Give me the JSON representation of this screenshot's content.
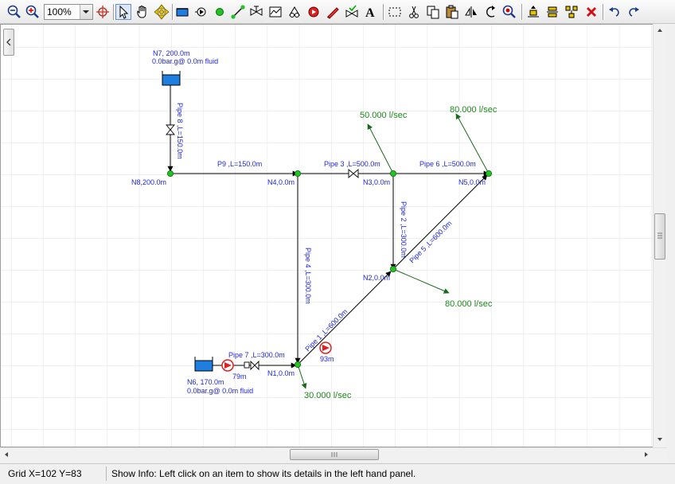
{
  "toolbar": {
    "zoom_value": "100%",
    "tools": [
      {
        "name": "zoom-out-icon"
      },
      {
        "name": "zoom-in-icon"
      },
      {
        "name": "zoom-target-icon"
      },
      {
        "name": "select-pointer-icon"
      },
      {
        "name": "pan-hand-icon"
      },
      {
        "name": "move-arrows-icon"
      },
      {
        "name": "tank-icon"
      },
      {
        "name": "pump-icon"
      },
      {
        "name": "node-icon"
      },
      {
        "name": "pipe-icon"
      },
      {
        "name": "valve-icon"
      },
      {
        "name": "chart-icon"
      },
      {
        "name": "component-icon"
      },
      {
        "name": "pump-red-icon"
      },
      {
        "name": "pencil-icon"
      },
      {
        "name": "check-valve-icon"
      },
      {
        "name": "text-icon"
      },
      {
        "name": "marquee-icon"
      },
      {
        "name": "cut-icon"
      },
      {
        "name": "copy-icon"
      },
      {
        "name": "paste-icon"
      },
      {
        "name": "flip-icon"
      },
      {
        "name": "rotate-icon"
      },
      {
        "name": "zoom-fit-icon"
      },
      {
        "name": "align-top-icon"
      },
      {
        "name": "align-middle-icon"
      },
      {
        "name": "distribute-icon"
      },
      {
        "name": "delete-icon"
      },
      {
        "name": "undo-icon"
      },
      {
        "name": "redo-icon"
      }
    ]
  },
  "diagram": {
    "labels": {
      "n7": "N7, 200.0m",
      "n7_sub": "0.0bar.g@ 0.0m fluid",
      "pipe8": "Pipe 8 ,L=150.0m",
      "n8": "N8,200.0m",
      "p9": "P9 ,L=150.0m",
      "n4": "N4,0.0m",
      "pipe3": "Pipe 3 ,L=500.0m",
      "n3": "N3,0.0m",
      "pipe6": "Pipe 6 ,L=500.0m",
      "n5": "N5,0.0m",
      "pipe2": "Pipe 2 ,L=300.0m",
      "pipe5": "Pipe 5 ,L=600.0m",
      "pipe4": "Pipe 4 ,L=300.0m",
      "n2": "N2,0.0m",
      "pipe1": "Pipe 1 ,L=600.0m",
      "pump93": "93m",
      "pipe7": "Pipe 7 ,L=300.0m",
      "pump79": "79m",
      "n1": "N1,0.0m",
      "n6": "N6, 170.0m",
      "n6_sub": "0.0bar.g@ 0.0m fluid"
    },
    "flows": {
      "f_n3": "50.000 l/sec",
      "f_n5": "80.000 l/sec",
      "f_n2": "80.000 l/sec",
      "f_n1": "30.000 l/sec"
    },
    "colors": {
      "pipe": "#000000",
      "node": "#22c322",
      "tank": "#1e7fe0",
      "pump": "#e02020",
      "label": "#1f27d6",
      "flow": "#1c8a1c",
      "grid": "#e2e2e2"
    }
  },
  "status": {
    "grid_label": "Grid  X=102  Y=83",
    "info": "Show Info: Left click on an item to show its details in the left hand panel."
  }
}
